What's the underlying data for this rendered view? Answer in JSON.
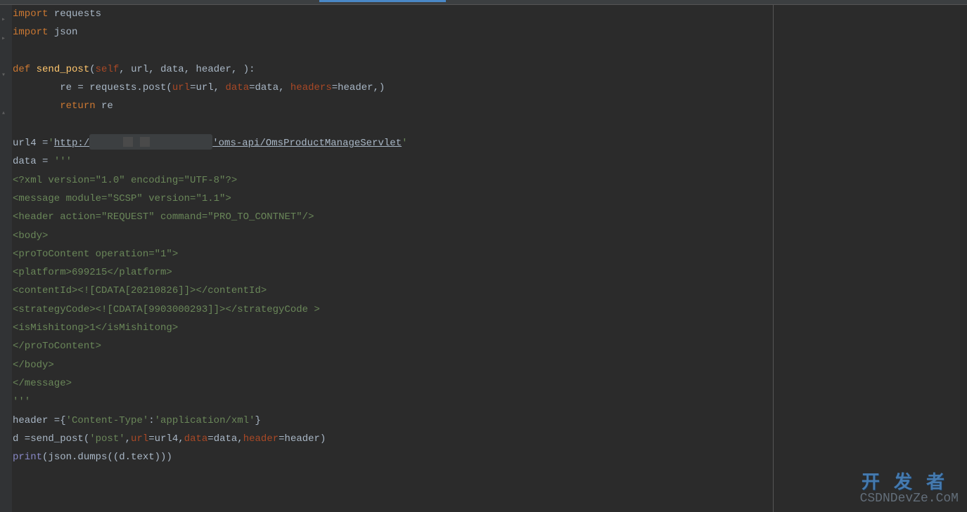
{
  "code": {
    "line1_kw": "import",
    "line1_mod": " requests",
    "line2_kw": "import",
    "line2_mod": " json",
    "line4_def": "def ",
    "line4_fn": "send_post",
    "line4_open": "(",
    "line4_self": "self",
    "line4_c1": ", ",
    "line4_p1": "url",
    "line4_c2": ", ",
    "line4_p2": "data",
    "line4_c3": ", ",
    "line4_p3": "header",
    "line4_c4": ", ):",
    "line5_indent": "        re = requests.post(",
    "line5_p1": "url",
    "line5_a1": "=url, ",
    "line5_p2": "data",
    "line5_a2": "=data, ",
    "line5_p3": "headers",
    "line5_a3": "=header,)",
    "line6_indent": "        ",
    "line6_kw": "return ",
    "line6_val": "re",
    "line8_a": "url4 =",
    "line8_s1": "'",
    "line8_url1": "http:/",
    "line8_url2": "'oms-api/OmsProductManageServlet",
    "line8_s2": "'",
    "line9_a": "data = ",
    "line9_s": "'''",
    "line10": "<?xml version=\"1.0\" encoding=\"UTF-8\"?>",
    "line11": "<message module=\"SCSP\" version=\"1.1\">",
    "line12": "<header action=\"REQUEST\" command=\"PRO_TO_CONTNET\"/>",
    "line13": "<body>",
    "line14": "<proToContent operation=\"1\">",
    "line15": "<platform>699215</platform>",
    "line16": "<contentId><![CDATA[20210826]]></contentId>",
    "line17": "<strategyCode><![CDATA[9903000293]]></strategyCode >",
    "line18": "<isMishitong>1</isMishitong>",
    "line19": "</proToContent>",
    "line20": "</body>",
    "line21": "</message>",
    "line22": "'''",
    "line23_a": "header ={",
    "line23_s1": "'Content-Type'",
    "line23_b": ":",
    "line23_s2": "'application/xml'",
    "line23_c": "}",
    "line24_a": "d =send_post(",
    "line24_s1": "'post'",
    "line24_b": ",",
    "line24_p1": "url",
    "line24_c": "=url4,",
    "line24_p2": "data",
    "line24_d": "=data,",
    "line24_p3": "header",
    "line24_e": "=header)",
    "line25_fn": "print",
    "line25_a": "(json.dumps((d.text)))"
  },
  "watermark": {
    "top": "开发者",
    "bottom": "CSDNDevZe.CoM"
  }
}
